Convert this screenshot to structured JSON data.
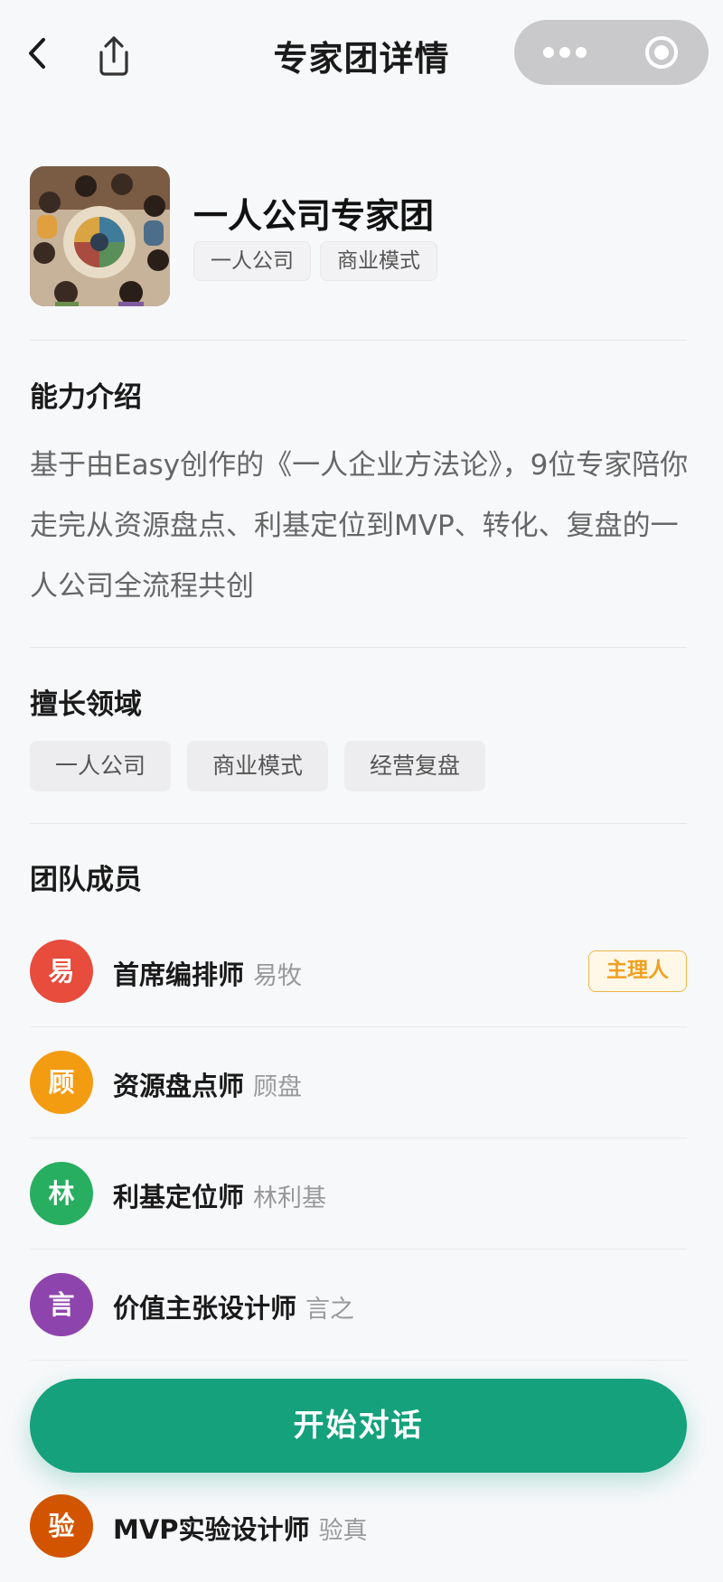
{
  "header": {
    "title": "专家团详情",
    "back_icon": "chevron-left-icon",
    "share_icon": "share-icon"
  },
  "profile": {
    "name": "一人公司专家团",
    "tags": [
      "一人公司",
      "商业模式"
    ]
  },
  "intro": {
    "title": "能力介绍",
    "text": "基于由Easy创作的《一人企业方法论》，9位专家陪你走完从资源盘点、利基定位到MVP、转化、复盘的一人公司全流程共创"
  },
  "domains": {
    "title": "擅长领域",
    "items": [
      "一人公司",
      "商业模式",
      "经营复盘"
    ]
  },
  "members": {
    "title": "团队成员",
    "host_label": "主理人",
    "items": [
      {
        "initial": "易",
        "role": "首席编排师",
        "name": "易牧",
        "color": "#e74c3c"
      },
      {
        "initial": "顾",
        "role": "资源盘点师",
        "name": "顾盘",
        "color": "#f39c12"
      },
      {
        "initial": "林",
        "role": "利基定位师",
        "name": "林利基",
        "color": "#27ae60"
      },
      {
        "initial": "言",
        "role": "价值主张设计师",
        "name": "言之",
        "color": "#8e44ad"
      },
      {
        "initial": "验",
        "role": "MVP实验设计师",
        "name": "验真",
        "color": "#d35400"
      }
    ]
  },
  "cta": {
    "label": "开始对话",
    "color": "#14a17c"
  }
}
